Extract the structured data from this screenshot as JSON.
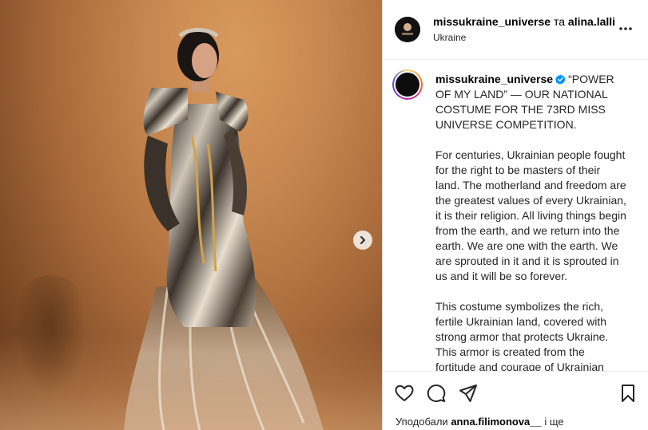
{
  "post": {
    "header": {
      "author": "missukraine_universe",
      "connector": "та",
      "coauthor": "alina.lalli",
      "location": "Ukraine"
    },
    "caption": {
      "username": "missukraine_universe",
      "paragraphs": [
        "“POWER OF MY LAND” — OUR NATIONAL COSTUME FOR THE 73RD MISS UNIVERSE COMPETITION.",
        "For centuries, Ukrainian people fought for the right to be masters of their land. The motherland and freedom are the greatest values of every Ukrainian, it is their religion. All living things begin from the earth, and we return into the earth. We are one with the earth. We are sprouted in it and it is sprouted in us and it will be so forever.",
        "This costume symbolizes the rich, fertile Ukrainian land, covered with strong armor that protects Ukraine. This armor is created from the fortitude and courage of Ukrainian"
      ]
    },
    "likes": {
      "prefix": "Уподобали",
      "user": "anna.filimonova__",
      "suffix": " і ще"
    }
  },
  "icons": {
    "more": "more-horizontal-icon",
    "next": "chevron-right-icon",
    "like": "heart-icon",
    "comment": "comment-icon",
    "share": "paper-plane-icon",
    "save": "bookmark-icon",
    "verified": "verified-badge-icon"
  },
  "colors": {
    "verified": "#0095f6",
    "text": "#262626",
    "background_warm": "#c6864f"
  }
}
